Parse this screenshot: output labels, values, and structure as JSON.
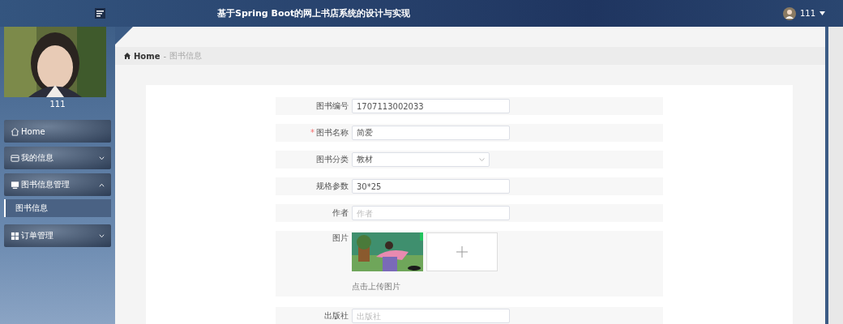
{
  "header": {
    "title": "基于Spring Boot的网上书店系统的设计与实现",
    "user": "111"
  },
  "sidebar": {
    "username": "111",
    "items": [
      {
        "label": "Home"
      },
      {
        "label": "我的信息",
        "expanded": false
      },
      {
        "label": "图书信息管理",
        "expanded": true,
        "children": [
          {
            "label": "图书信息",
            "selected": true
          }
        ]
      },
      {
        "label": "订单管理",
        "expanded": false
      }
    ]
  },
  "breadcrumb": {
    "home": "Home",
    "separator": "-",
    "current": "图书信息"
  },
  "form": {
    "fields": [
      {
        "kind": "text",
        "label": "图书编号",
        "value": "1707113002033"
      },
      {
        "kind": "text",
        "label": "图书名称",
        "required_mark": "*",
        "value": "简爱"
      },
      {
        "kind": "select",
        "label": "图书分类",
        "value": "教材"
      },
      {
        "kind": "text",
        "label": "规格参数",
        "value": "30*25"
      },
      {
        "kind": "text",
        "label": "作者",
        "placeholder": "作者"
      },
      {
        "kind": "upload",
        "label": "图片",
        "hint": "点击上传图片"
      },
      {
        "kind": "text",
        "label": "出版社",
        "placeholder": "出版社"
      }
    ]
  }
}
